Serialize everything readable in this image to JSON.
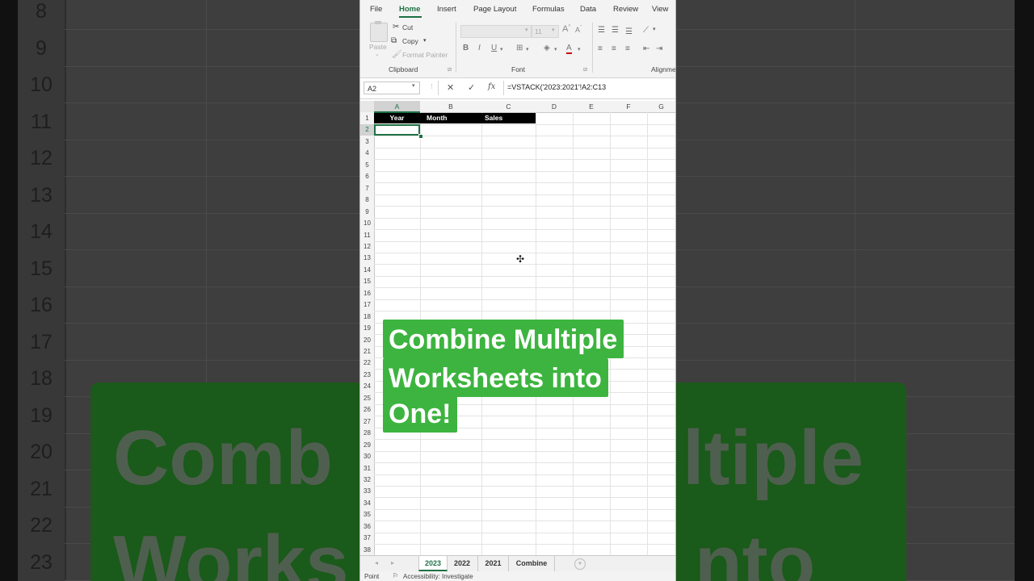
{
  "ribbon": {
    "tabs": [
      "File",
      "Home",
      "Insert",
      "Page Layout",
      "Formulas",
      "Data",
      "Review",
      "View"
    ],
    "active_tab": "Home",
    "clipboard": {
      "paste": "Paste",
      "cut": "Cut",
      "copy": "Copy",
      "format_painter": "Format Painter",
      "group_label": "Clipboard"
    },
    "font": {
      "size": "11",
      "bold": "B",
      "italic": "I",
      "underline": "U",
      "group_label": "Font"
    },
    "alignment_label": "Alignme"
  },
  "formula_bar": {
    "name_box": "A2",
    "cancel_icon": "✕",
    "enter_icon": "✓",
    "fx": "fx",
    "formula": "=VSTACK('2023:2021'!A2:C13"
  },
  "grid": {
    "columns": [
      "A",
      "B",
      "C",
      "D",
      "E",
      "F",
      "G"
    ],
    "rows": [
      "1",
      "2",
      "3",
      "4",
      "5",
      "6",
      "7",
      "8",
      "9",
      "10",
      "11",
      "12",
      "13",
      "14",
      "15",
      "16",
      "17",
      "18",
      "19",
      "20",
      "21",
      "22",
      "23",
      "24",
      "25",
      "26",
      "27",
      "28",
      "29",
      "30",
      "31",
      "32",
      "33",
      "34",
      "35",
      "36",
      "37",
      "38"
    ],
    "header_row": [
      "Year",
      "Month",
      "Sales"
    ],
    "selected_cell": "A2"
  },
  "sheet_tabs": [
    "2023",
    "2022",
    "2021",
    "Combine"
  ],
  "active_sheet": "2023",
  "status_bar": {
    "mode": "Point",
    "accessibility": "Accessibility: Investigate"
  },
  "overlay": {
    "lines": [
      "Combine Multiple",
      "Worksheets into",
      "One!"
    ],
    "color": "#3db43f"
  },
  "background": {
    "row_numbers": [
      "8",
      "9",
      "10",
      "11",
      "12",
      "13",
      "14",
      "15",
      "16",
      "17",
      "18",
      "19",
      "20",
      "21",
      "22",
      "23"
    ],
    "fragment_line1_left": "Comb",
    "fragment_line1_right": "ltiple",
    "fragment_line2_left": "Works",
    "fragment_line2_right": "nto"
  }
}
